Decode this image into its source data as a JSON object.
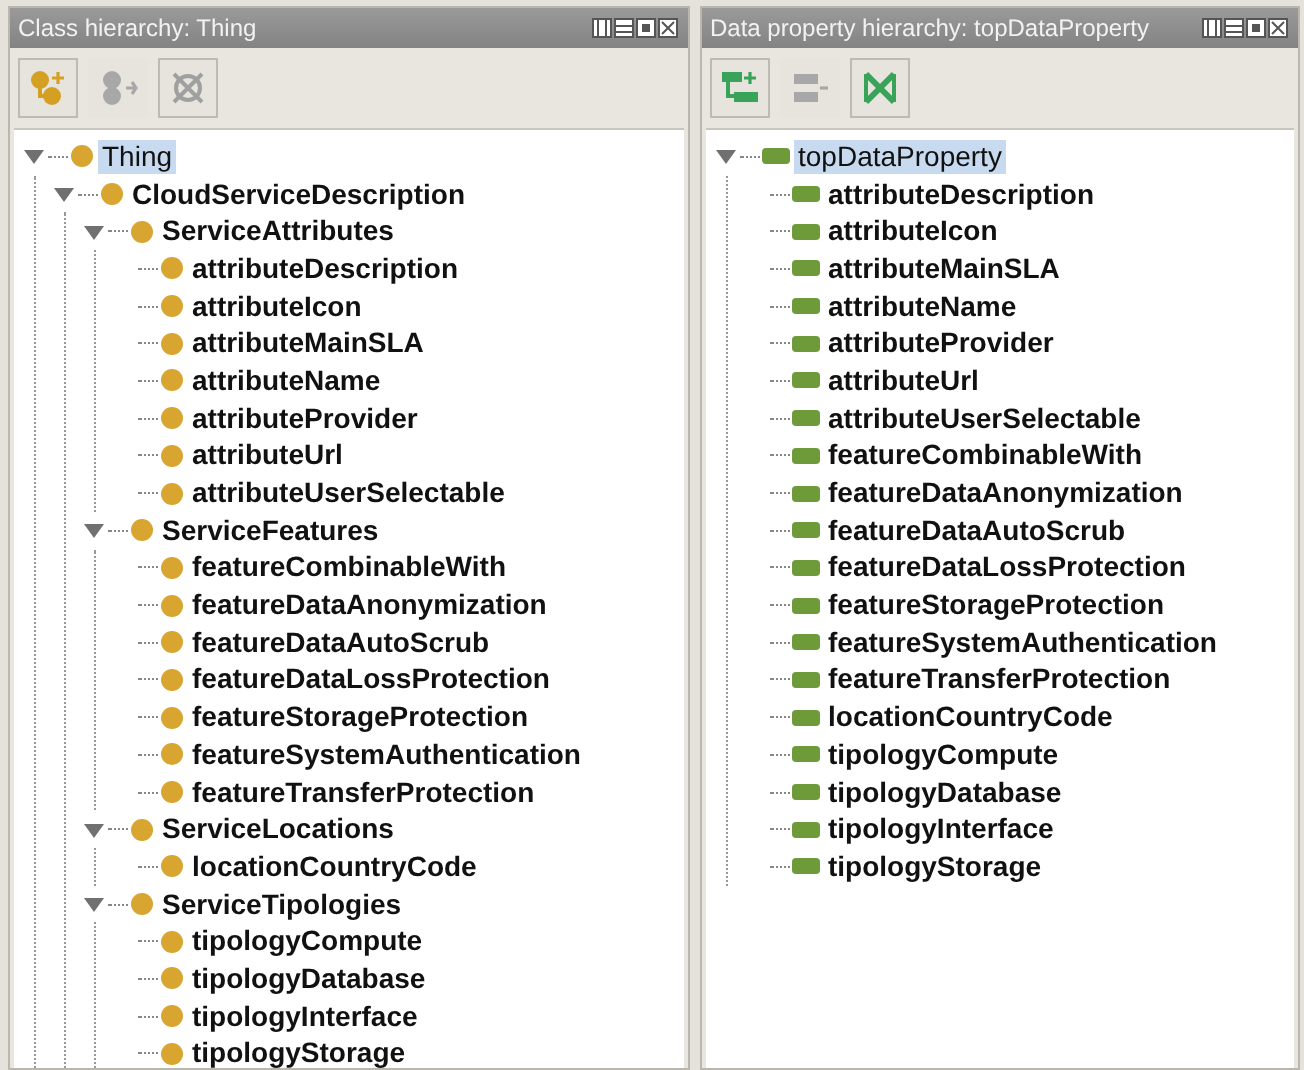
{
  "panels": [
    {
      "title": "Class hierarchy: Thing",
      "kind": "class",
      "tools": [
        {
          "kind": "add-child",
          "disabled": false
        },
        {
          "kind": "add-sibling",
          "disabled": true
        },
        {
          "kind": "delete",
          "disabled": false
        }
      ],
      "tree": [
        {
          "label": "Thing",
          "bold": false,
          "selected": true,
          "expanded": true,
          "children": [
            {
              "label": "CloudServiceDescription",
              "bold": true,
              "selected": false,
              "expanded": true,
              "children": [
                {
                  "label": "ServiceAttributes",
                  "bold": true,
                  "selected": false,
                  "expanded": true,
                  "children": [
                    {
                      "label": "attributeDescription",
                      "bold": true,
                      "selected": false
                    },
                    {
                      "label": "attributeIcon",
                      "bold": true,
                      "selected": false
                    },
                    {
                      "label": "attributeMainSLA",
                      "bold": true,
                      "selected": false
                    },
                    {
                      "label": "attributeName",
                      "bold": true,
                      "selected": false
                    },
                    {
                      "label": "attributeProvider",
                      "bold": true,
                      "selected": false
                    },
                    {
                      "label": "attributeUrl",
                      "bold": true,
                      "selected": false
                    },
                    {
                      "label": "attributeUserSelectable",
                      "bold": true,
                      "selected": false
                    }
                  ]
                },
                {
                  "label": "ServiceFeatures",
                  "bold": true,
                  "selected": false,
                  "expanded": true,
                  "children": [
                    {
                      "label": "featureCombinableWith",
                      "bold": true,
                      "selected": false
                    },
                    {
                      "label": "featureDataAnonymization",
                      "bold": true,
                      "selected": false
                    },
                    {
                      "label": "featureDataAutoScrub",
                      "bold": true,
                      "selected": false
                    },
                    {
                      "label": "featureDataLossProtection",
                      "bold": true,
                      "selected": false
                    },
                    {
                      "label": "featureStorageProtection",
                      "bold": true,
                      "selected": false
                    },
                    {
                      "label": "featureSystemAuthentication",
                      "bold": true,
                      "selected": false
                    },
                    {
                      "label": "featureTransferProtection",
                      "bold": true,
                      "selected": false
                    }
                  ]
                },
                {
                  "label": "ServiceLocations",
                  "bold": true,
                  "selected": false,
                  "expanded": true,
                  "children": [
                    {
                      "label": "locationCountryCode",
                      "bold": true,
                      "selected": false
                    }
                  ]
                },
                {
                  "label": "ServiceTipologies",
                  "bold": true,
                  "selected": false,
                  "expanded": true,
                  "children": [
                    {
                      "label": "tipologyCompute",
                      "bold": true,
                      "selected": false
                    },
                    {
                      "label": "tipologyDatabase",
                      "bold": true,
                      "selected": false
                    },
                    {
                      "label": "tipologyInterface",
                      "bold": true,
                      "selected": false
                    },
                    {
                      "label": "tipologyStorage",
                      "bold": true,
                      "selected": false
                    }
                  ]
                }
              ]
            }
          ]
        }
      ]
    },
    {
      "title": "Data property hierarchy: topDataProperty",
      "kind": "property",
      "tools": [
        {
          "kind": "add-child",
          "disabled": false
        },
        {
          "kind": "add-sibling",
          "disabled": true
        },
        {
          "kind": "delete",
          "disabled": false
        }
      ],
      "tree": [
        {
          "label": "topDataProperty",
          "bold": false,
          "selected": true,
          "expanded": true,
          "children": [
            {
              "label": "attributeDescription",
              "bold": true,
              "selected": false
            },
            {
              "label": "attributeIcon",
              "bold": true,
              "selected": false
            },
            {
              "label": "attributeMainSLA",
              "bold": true,
              "selected": false
            },
            {
              "label": "attributeName",
              "bold": true,
              "selected": false
            },
            {
              "label": "attributeProvider",
              "bold": true,
              "selected": false
            },
            {
              "label": "attributeUrl",
              "bold": true,
              "selected": false
            },
            {
              "label": "attributeUserSelectable",
              "bold": true,
              "selected": false
            },
            {
              "label": "featureCombinableWith",
              "bold": true,
              "selected": false
            },
            {
              "label": "featureDataAnonymization",
              "bold": true,
              "selected": false
            },
            {
              "label": "featureDataAutoScrub",
              "bold": true,
              "selected": false
            },
            {
              "label": "featureDataLossProtection",
              "bold": true,
              "selected": false
            },
            {
              "label": "featureStorageProtection",
              "bold": true,
              "selected": false
            },
            {
              "label": "featureSystemAuthentication",
              "bold": true,
              "selected": false
            },
            {
              "label": "featureTransferProtection",
              "bold": true,
              "selected": false
            },
            {
              "label": "locationCountryCode",
              "bold": true,
              "selected": false
            },
            {
              "label": "tipologyCompute",
              "bold": true,
              "selected": false
            },
            {
              "label": "tipologyDatabase",
              "bold": true,
              "selected": false
            },
            {
              "label": "tipologyInterface",
              "bold": true,
              "selected": false
            },
            {
              "label": "tipologyStorage",
              "bold": true,
              "selected": false
            }
          ]
        }
      ]
    }
  ]
}
